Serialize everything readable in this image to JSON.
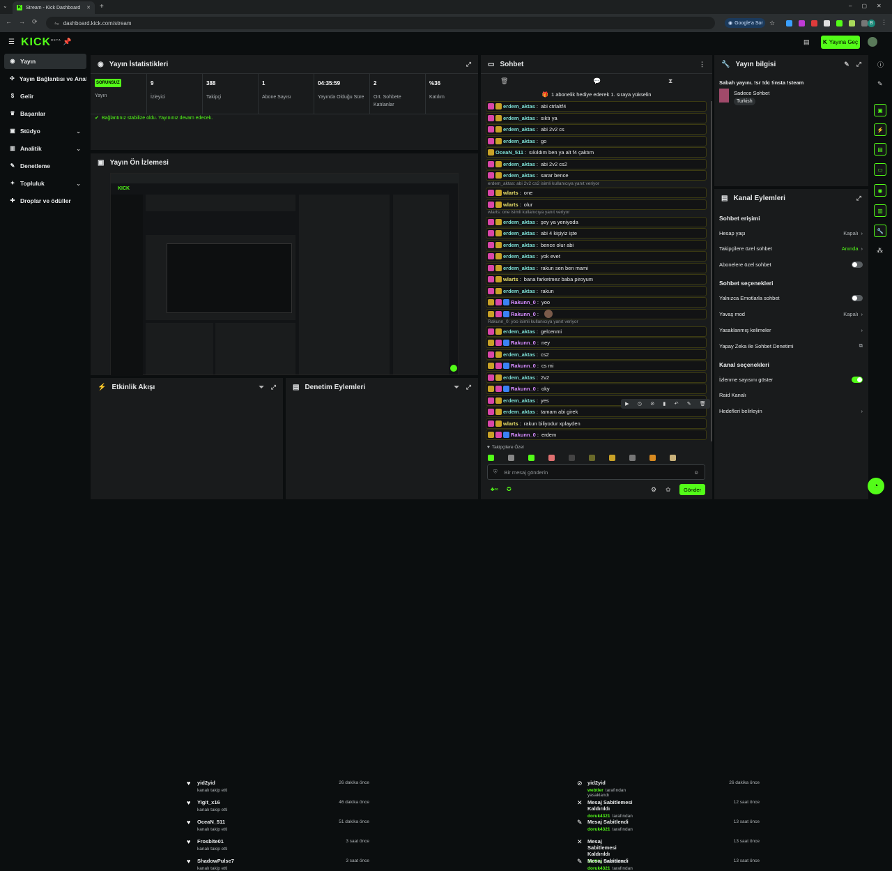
{
  "browser": {
    "tab_title": "Stream - Kick Dashboard",
    "url": "dashboard.kick.com/stream",
    "google_btn": "Google'a Sor",
    "profile_initial": "B"
  },
  "header": {
    "logo": "KICK",
    "logo_sup": "BETA",
    "go_live": "Yayına Geç"
  },
  "sidebar": {
    "items": [
      {
        "label": "Yayın",
        "icon": "broadcast-icon"
      },
      {
        "label": "Yayın Bağlantısı ve Anahtarı",
        "icon": "link-icon"
      },
      {
        "label": "Gelir",
        "icon": "money-icon"
      },
      {
        "label": "Başarılar",
        "icon": "trophy-icon"
      },
      {
        "label": "Stüdyo",
        "icon": "studio-icon"
      },
      {
        "label": "Analitik",
        "icon": "chart-icon"
      },
      {
        "label": "Denetleme",
        "icon": "hammer-icon"
      },
      {
        "label": "Topluluk",
        "icon": "community-icon"
      },
      {
        "label": "Droplar ve ödüller",
        "icon": "gift-icon"
      }
    ]
  },
  "stats": {
    "title": "Yayın İstatistikleri",
    "status": "SORUNSUZ",
    "status_label": "Yayın",
    "items": [
      {
        "value": "9",
        "label": "İzleyici"
      },
      {
        "value": "388",
        "label": "Takipçi"
      },
      {
        "value": "1",
        "label": "Abone Sayısı"
      },
      {
        "value": "04:35:59",
        "label": "Yayında Olduğu Süre"
      },
      {
        "value": "2",
        "label": "Ort. Sohbete Katılanlar"
      },
      {
        "value": "%36",
        "label": "Katılım"
      }
    ],
    "notice": "Bağlantınız stabilize oldu. Yayınınız devam edecek."
  },
  "preview": {
    "title": "Yayın Ön İzlemesi"
  },
  "activity": {
    "title": "Etkinlik Akışı",
    "items": [
      {
        "name": "yid2yid",
        "sub": "kanalı takip etti",
        "time": "26 dakika önce"
      },
      {
        "name": "Yigit_x16",
        "sub": "kanalı takip etti",
        "time": "46 dakika önce"
      },
      {
        "name": "OceaN_511",
        "sub": "kanalı takip etti",
        "time": "51 dakika önce"
      },
      {
        "name": "Frosbite01",
        "sub": "kanalı takip etti",
        "time": "3 saat önce"
      },
      {
        "name": "ShadowPulse7",
        "sub": "kanalı takip etti",
        "time": "3 saat önce"
      }
    ]
  },
  "modlog": {
    "title": "Denetim Eylemleri",
    "items": [
      {
        "name": "yid2yid",
        "by": "webtler",
        "sub": "tarafından yasaklandı",
        "time": "26 dakika önce"
      },
      {
        "name": "Mesaj Sabitlemesi Kaldırıldı",
        "by": "doruk4321",
        "sub": "tarafından",
        "time": "12 saat önce"
      },
      {
        "name": "Mesaj Sabitlendi",
        "by": "doruk4321",
        "sub": "tarafından",
        "time": "13 saat önce"
      },
      {
        "name": "Mesaj Sabitlemesi Kaldırıldı",
        "by": "BeXKa",
        "sub": "tarafından",
        "time": "13 saat önce"
      },
      {
        "name": "Mesaj Sabitlendi",
        "by": "doruk4321",
        "sub": "tarafından",
        "time": "13 saat önce"
      }
    ]
  },
  "chat": {
    "title": "Sohbet",
    "gift_banner": "1 abonelik hediye ederek 1. sıraya yükselin",
    "messages": [
      {
        "user": "erdem_aktas",
        "text": "abi ctrlaltf4",
        "color": "c",
        "badges": [
          "p",
          "y"
        ]
      },
      {
        "user": "erdem_aktas",
        "text": "sıktı ya",
        "color": "c",
        "badges": [
          "p",
          "y"
        ]
      },
      {
        "user": "erdem_aktas",
        "text": "abi 2v2 cs",
        "color": "c",
        "badges": [
          "p",
          "y"
        ]
      },
      {
        "user": "erdem_aktas",
        "text": "go",
        "color": "c",
        "badges": [
          "p",
          "y"
        ]
      },
      {
        "user": "OceaN_511",
        "text": "sıkıldım ben ya alt f4 çaktım",
        "color": "c",
        "badges": [
          "y"
        ]
      },
      {
        "user": "erdem_aktas",
        "text": "abi 2v2 cs2",
        "color": "c",
        "badges": [
          "p",
          "y"
        ]
      },
      {
        "user": "erdem_aktas",
        "text": "sarar bence",
        "color": "c",
        "badges": [
          "p",
          "y"
        ]
      },
      {
        "user": "wlarts",
        "text": "one",
        "color": "y2",
        "badges": [
          "p",
          "y"
        ]
      },
      {
        "user": "wlarts",
        "text": "olur",
        "color": "y2",
        "badges": [
          "p",
          "y"
        ]
      },
      {
        "user": "erdem_aktas",
        "text": "şey ya yeniyoda",
        "color": "c",
        "badges": [
          "p",
          "y"
        ]
      },
      {
        "user": "erdem_aktas",
        "text": "abi 4 kişiyiz işte",
        "color": "c",
        "badges": [
          "p",
          "y"
        ]
      },
      {
        "user": "erdem_aktas",
        "text": "bence olur abi",
        "color": "c",
        "badges": [
          "p",
          "y"
        ]
      },
      {
        "user": "erdem_aktas",
        "text": "yok evet",
        "color": "c",
        "badges": [
          "p",
          "y"
        ]
      },
      {
        "user": "erdem_aktas",
        "text": "rakun sen ben mami",
        "color": "c",
        "badges": [
          "p",
          "y"
        ]
      },
      {
        "user": "wlarts",
        "text": "bana farketmez baba piroyum",
        "color": "y2",
        "badges": [
          "p",
          "y"
        ]
      },
      {
        "user": "erdem_aktas",
        "text": "rakun",
        "color": "c",
        "badges": [
          "p",
          "y"
        ]
      },
      {
        "user": "Rakunn_0",
        "text": "yoo",
        "color": "pk",
        "badges": [
          "y",
          "p",
          "b"
        ]
      },
      {
        "user": "Rakunn_0",
        "text": "",
        "color": "pk",
        "badges": [
          "y",
          "p",
          "b"
        ]
      },
      {
        "user": "erdem_aktas",
        "text": "gelcenmi",
        "color": "c",
        "badges": [
          "p",
          "y"
        ]
      },
      {
        "user": "Rakunn_0",
        "text": "ney",
        "color": "pk",
        "badges": [
          "y",
          "p",
          "b"
        ]
      },
      {
        "user": "erdem_aktas",
        "text": "cs2",
        "color": "c",
        "badges": [
          "p",
          "y"
        ]
      },
      {
        "user": "Rakunn_0",
        "text": "cs mi",
        "color": "pk",
        "badges": [
          "y",
          "p",
          "b"
        ]
      },
      {
        "user": "erdem_aktas",
        "text": "2v2",
        "color": "c",
        "badges": [
          "p",
          "y"
        ]
      },
      {
        "user": "Rakunn_0",
        "text": "oky",
        "color": "pk",
        "badges": [
          "y",
          "p",
          "b"
        ]
      },
      {
        "user": "erdem_aktas",
        "text": "yes",
        "color": "c",
        "badges": [
          "p",
          "y"
        ]
      },
      {
        "user": "erdem_aktas",
        "text": "tamam abi girek",
        "color": "c",
        "badges": [
          "p",
          "y"
        ]
      },
      {
        "user": "wlarts",
        "text": "rakun biliyodur xplayden",
        "color": "y2",
        "badges": [
          "p",
          "y"
        ]
      },
      {
        "user": "Rakunn_0",
        "text": "erdem",
        "color": "pk",
        "badges": [
          "y",
          "p",
          "b"
        ]
      }
    ],
    "replies": [
      {
        "after": 6,
        "text": "erdem_aktas: abi 2v2 cs2 isimli kullanıcıya yanıt veriyor"
      },
      {
        "after": 8,
        "text": "wlarts: one isimli kullanıcıya yanıt veriyor"
      },
      {
        "after": 17,
        "text": "Rakunn_0: yoo isimli kullanıcıya yanıt veriyor"
      }
    ],
    "followers_only": "Takipçilere Özel",
    "placeholder": "Bir mesaj gönderin",
    "send": "Gönder"
  },
  "info": {
    "title": "Yayın bilgisi",
    "stream_title": "Sabah yayını. !sr !dc !insta !steam",
    "category": "Sadece Sohbet",
    "tag": "Turkish"
  },
  "actions": {
    "title": "Kanal Eylemleri",
    "chat_access": "Sohbet erişimi",
    "account_age": "Hesap yaşı",
    "account_age_val": "Kapalı",
    "followers_chat": "Takipçilere özel sohbet",
    "followers_chat_val": "Anında",
    "subs_chat": "Abonelere özel sohbet",
    "chat_options": "Sohbet seçenekleri",
    "emotes_only": "Yalnızca Emotlarla sohbet",
    "slow_mode": "Yavaş mod",
    "slow_mode_val": "Kapalı",
    "banned_words": "Yasaklanmış kelimeler",
    "ai_mod": "Yapay Zeka ile Sohbet Denetimi",
    "channel_options": "Kanal seçenekleri",
    "show_views": "İzlenme sayısını göster",
    "raid": "Raid Kanalı",
    "goals": "Hedefleri belirleyin",
    "toggles": {
      "subs_chat": false,
      "emotes_only": false,
      "show_views": true
    }
  }
}
